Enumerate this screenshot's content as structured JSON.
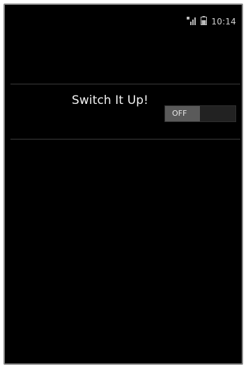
{
  "status_bar": {
    "time": "10:14",
    "icons": [
      "signal-icon",
      "battery-icon"
    ]
  },
  "switch_row": {
    "label": "Switch It Up!",
    "switch": {
      "state_label": "OFF",
      "checked": false
    }
  },
  "colors": {
    "background": "#000000",
    "text": "#f2f2f2",
    "switch_track": "#222222",
    "switch_thumb": "#5a5a5a",
    "divider": "#3b3b3b"
  }
}
